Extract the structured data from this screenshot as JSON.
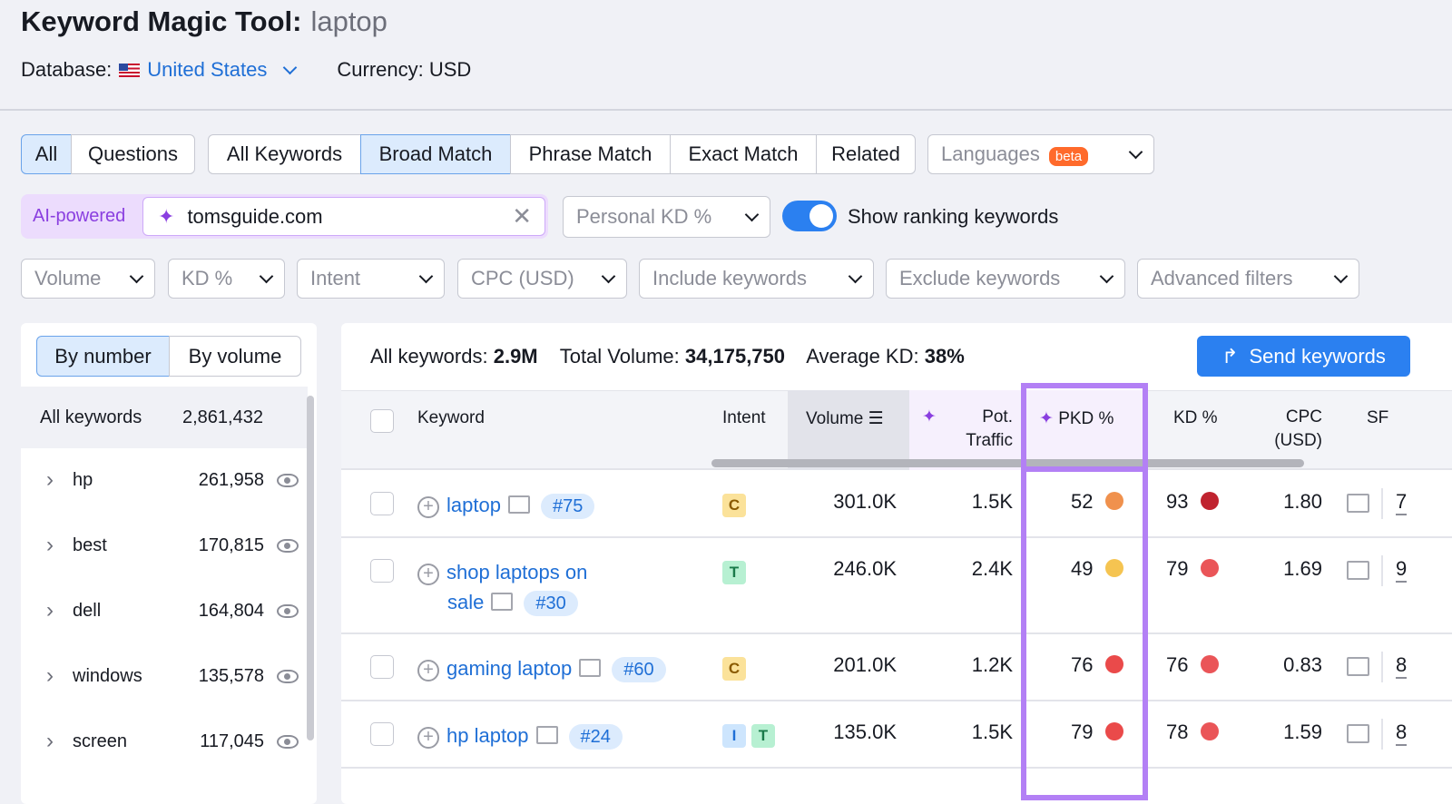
{
  "header": {
    "title": "Keyword Magic Tool:",
    "query": "laptop",
    "database_label": "Database:",
    "database": "United States",
    "currency": "Currency: USD"
  },
  "tabs": {
    "group1": [
      "All",
      "Questions"
    ],
    "group2": [
      "All Keywords",
      "Broad Match",
      "Phrase Match",
      "Exact Match",
      "Related"
    ],
    "languages": "Languages",
    "beta": "beta",
    "selected": [
      "All",
      "Broad Match"
    ]
  },
  "ai": {
    "label": "AI-powered",
    "domain": "tomsguide.com",
    "personal_kd": "Personal KD %",
    "toggle_label": "Show ranking keywords",
    "toggle_on": true
  },
  "filters": [
    "Volume",
    "KD %",
    "Intent",
    "CPC (USD)",
    "Include keywords",
    "Exclude keywords",
    "Advanced filters"
  ],
  "sidebar": {
    "by_number": "By number",
    "by_volume": "By volume",
    "all_label": "All keywords",
    "all_count": "2,861,432",
    "groups": [
      {
        "name": "hp",
        "count": "261,958"
      },
      {
        "name": "best",
        "count": "170,815"
      },
      {
        "name": "dell",
        "count": "164,804"
      },
      {
        "name": "windows",
        "count": "135,578"
      },
      {
        "name": "screen",
        "count": "117,045"
      }
    ]
  },
  "summary": {
    "all_label": "All keywords:",
    "all": "2.9M",
    "vol_label": "Total Volume:",
    "vol": "34,175,750",
    "kd_label": "Average KD:",
    "kd": "38%",
    "send": "Send keywords"
  },
  "columns": {
    "keyword": "Keyword",
    "intent": "Intent",
    "volume": "Volume",
    "pot1": "Pot.",
    "pot2": "Traffic",
    "pkd": "PKD %",
    "kd": "KD %",
    "cpc1": "CPC",
    "cpc2": "(USD)",
    "sf": "SF"
  },
  "rows": [
    {
      "keyword": "laptop",
      "keyword2": "",
      "pos": "#75",
      "intents": [
        "C"
      ],
      "volume": "301.0K",
      "traffic": "1.5K",
      "pkd": "52",
      "pkd_color": "#f0914d",
      "kd": "93",
      "kd_color": "#c0232f",
      "cpc": "1.80",
      "sf": "7"
    },
    {
      "keyword": "shop laptops on",
      "keyword2": "sale",
      "pos": "#30",
      "intents": [
        "T"
      ],
      "volume": "246.0K",
      "traffic": "2.4K",
      "pkd": "49",
      "pkd_color": "#f5c451",
      "kd": "79",
      "kd_color": "#ea5558",
      "cpc": "1.69",
      "sf": "9"
    },
    {
      "keyword": "gaming laptop",
      "keyword2": "",
      "pos": "#60",
      "intents": [
        "C"
      ],
      "volume": "201.0K",
      "traffic": "1.2K",
      "pkd": "76",
      "pkd_color": "#ea4a4a",
      "kd": "76",
      "kd_color": "#ea5558",
      "cpc": "0.83",
      "sf": "8"
    },
    {
      "keyword": "hp laptop",
      "keyword2": "",
      "pos": "#24",
      "intents": [
        "I",
        "T"
      ],
      "volume": "135.0K",
      "traffic": "1.5K",
      "pkd": "79",
      "pkd_color": "#ea4a4a",
      "kd": "78",
      "kd_color": "#ea5558",
      "cpc": "1.59",
      "sf": "8"
    }
  ],
  "colors": {
    "accent": "#2b80f0",
    "highlight": "#b380f5",
    "ai": "#8a3fe0"
  }
}
